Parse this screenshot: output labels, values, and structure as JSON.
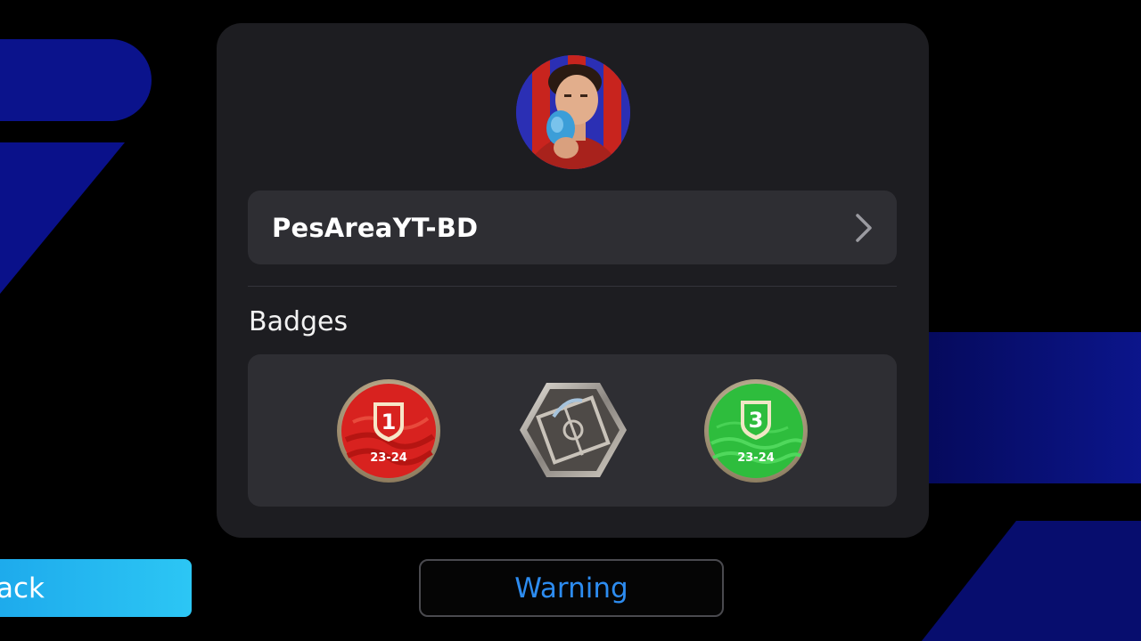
{
  "profile": {
    "name": "PesAreaYT-BD",
    "avatar_icon": "player-avatar"
  },
  "badges": {
    "title": "Badges",
    "items": [
      {
        "rank": "1",
        "season": "23-24",
        "color": "#d8221f",
        "icon": "shield-icon"
      },
      {
        "rank": "",
        "season": "",
        "color": "#6e6a66",
        "icon": "pitch-hexagon-icon"
      },
      {
        "rank": "3",
        "season": "23-24",
        "color": "#2ebd3d",
        "icon": "shield-icon"
      }
    ]
  },
  "buttons": {
    "back_label": "ack",
    "warning_label": "Warning"
  },
  "colors": {
    "card": "#1d1d21",
    "panel": "#2e2e33",
    "accent_blue": "#2d8cf0",
    "back_button": "#1aa3ea",
    "background_shapes": "#0b138c"
  }
}
